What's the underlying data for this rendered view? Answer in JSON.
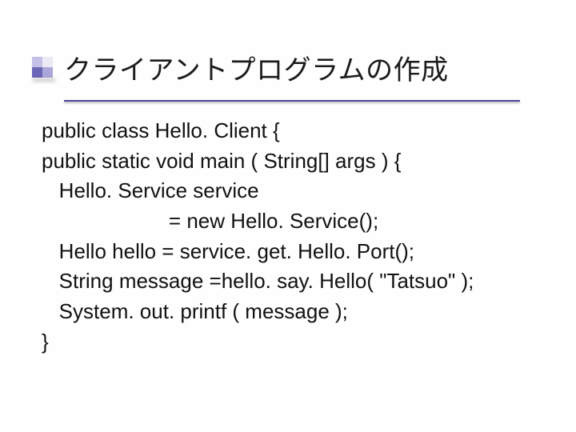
{
  "title": "クライアントプログラムの作成",
  "code": {
    "l1": "public class Hello. Client {",
    "l2": "public static void main ( String[] args ) {",
    "l3": "   Hello. Service service",
    "l4": "                      = new Hello. Service();",
    "l5": "   Hello hello = service. get. Hello. Port();",
    "l6": "   String message =hello. say. Hello( \"Tatsuo\" );",
    "l7": "   System. out. printf ( message );",
    "l8": "}"
  }
}
